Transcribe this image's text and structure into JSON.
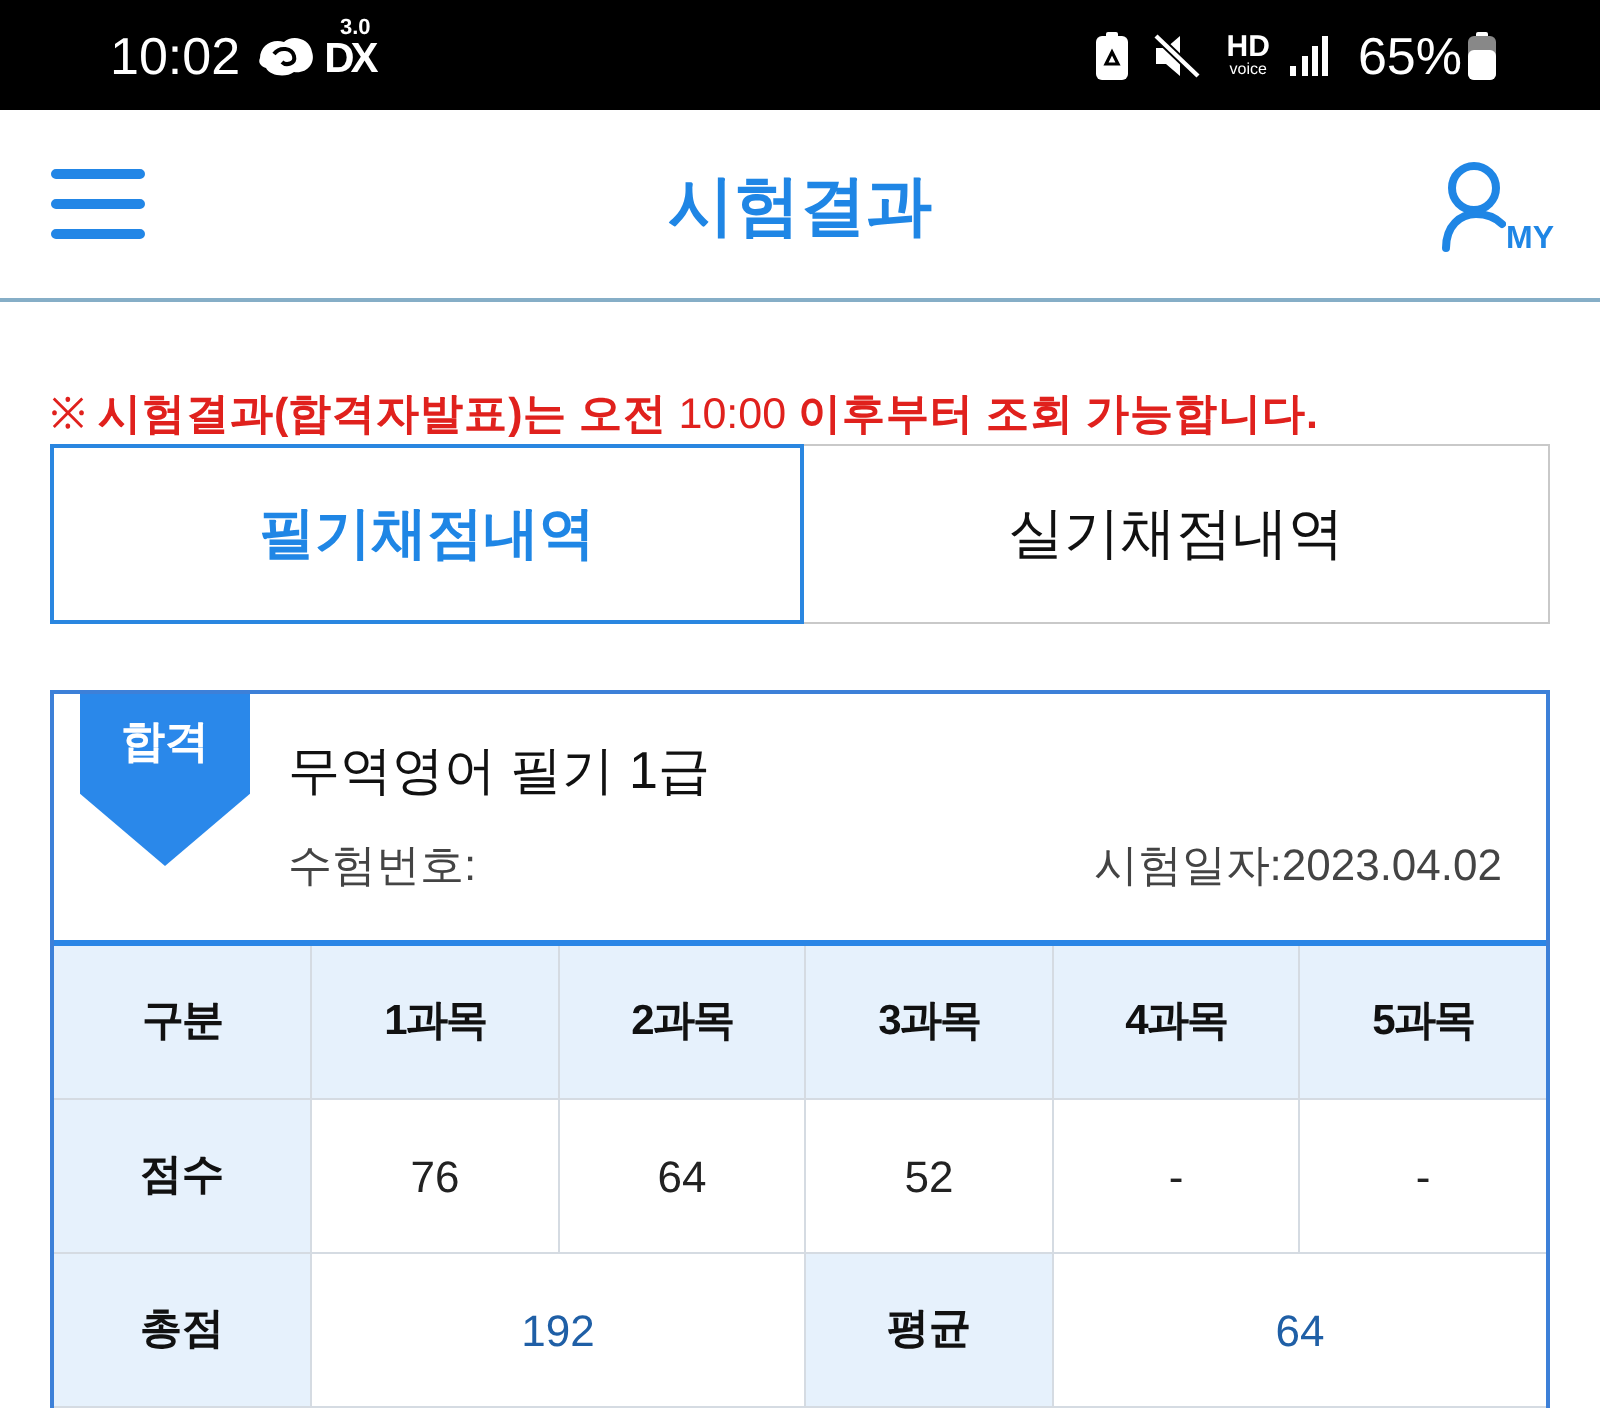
{
  "status_bar": {
    "time": "10:02",
    "network": {
      "type": "DX",
      "version": "3.0"
    },
    "hd_voice": {
      "label": "HD",
      "sublabel": "voice"
    },
    "battery_percent": "65%"
  },
  "header": {
    "title": "시험결과",
    "account_label": "MY"
  },
  "notice": "※ **시험결과(합격자발표)는 오전** 10:00 **이후부터 조회 가능합니다.**",
  "tabs": [
    {
      "label": "필기채점내역",
      "selected": true
    },
    {
      "label": "실기채점내역",
      "selected": false
    }
  ],
  "result": {
    "badge": "합격",
    "title": "무역영어 필기 1급",
    "exam_number_label": "수험번호:",
    "exam_date": "시험일자:2023.04.02"
  },
  "table": {
    "columns": [
      "구분",
      "1과목",
      "2과목",
      "3과목",
      "4과목",
      "5과목"
    ],
    "rows": [
      {
        "kind": "scores",
        "label": "점수",
        "cells": [
          "76",
          "64",
          "52",
          "-",
          "-"
        ]
      },
      {
        "kind": "summary",
        "items": [
          {
            "label": "총점",
            "value": "192"
          },
          {
            "label": "평균",
            "value": "64"
          }
        ]
      }
    ]
  }
}
